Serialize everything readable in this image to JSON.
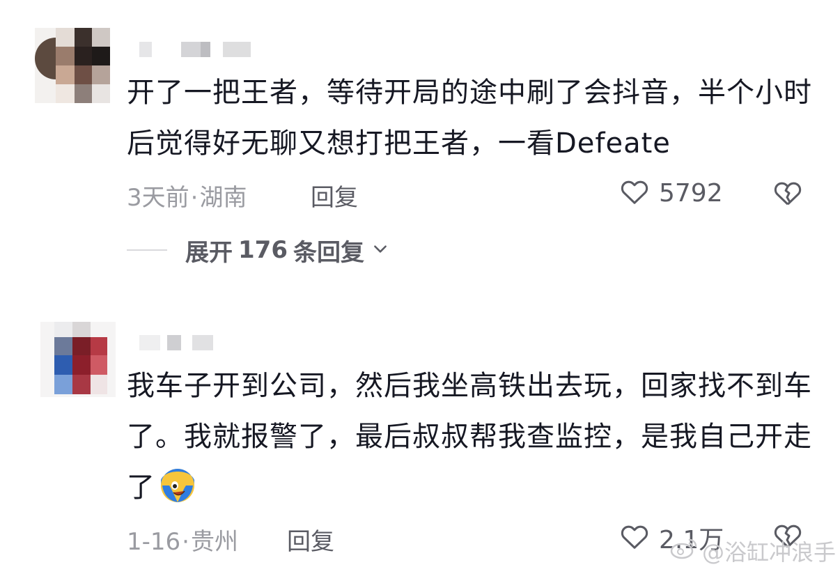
{
  "comments": [
    {
      "text": "开了一把王者，等待开局的途中刷了会抖音，半个小时后觉得好无聊又想打把王者，一看Defeate",
      "time": "3天前",
      "separator": "·",
      "location": "湖南",
      "reply_label": "回复",
      "likes": "5792",
      "expand": {
        "prefix": "展开",
        "count": "176",
        "suffix": "条回复"
      }
    },
    {
      "text": "我车子开到公司，然后我坐高铁出去玩，回家找不到车了。我就报警了，最后叔叔帮我查监控，是我自己开走了",
      "time": "1-16",
      "separator": "·",
      "location": "贵州",
      "reply_label": "回复",
      "likes": "2.1万",
      "emoji": "laughing-crying-emoji"
    }
  ],
  "watermark": {
    "text": "@浴缸冲浪手"
  },
  "colors": {
    "text_primary": "#161823",
    "text_secondary": "#9a9ba1",
    "action": "#5a5b63",
    "background": "#ffffff"
  },
  "icons": [
    "heart-icon",
    "broken-heart-icon",
    "chevron-down-icon",
    "weibo-icon"
  ]
}
